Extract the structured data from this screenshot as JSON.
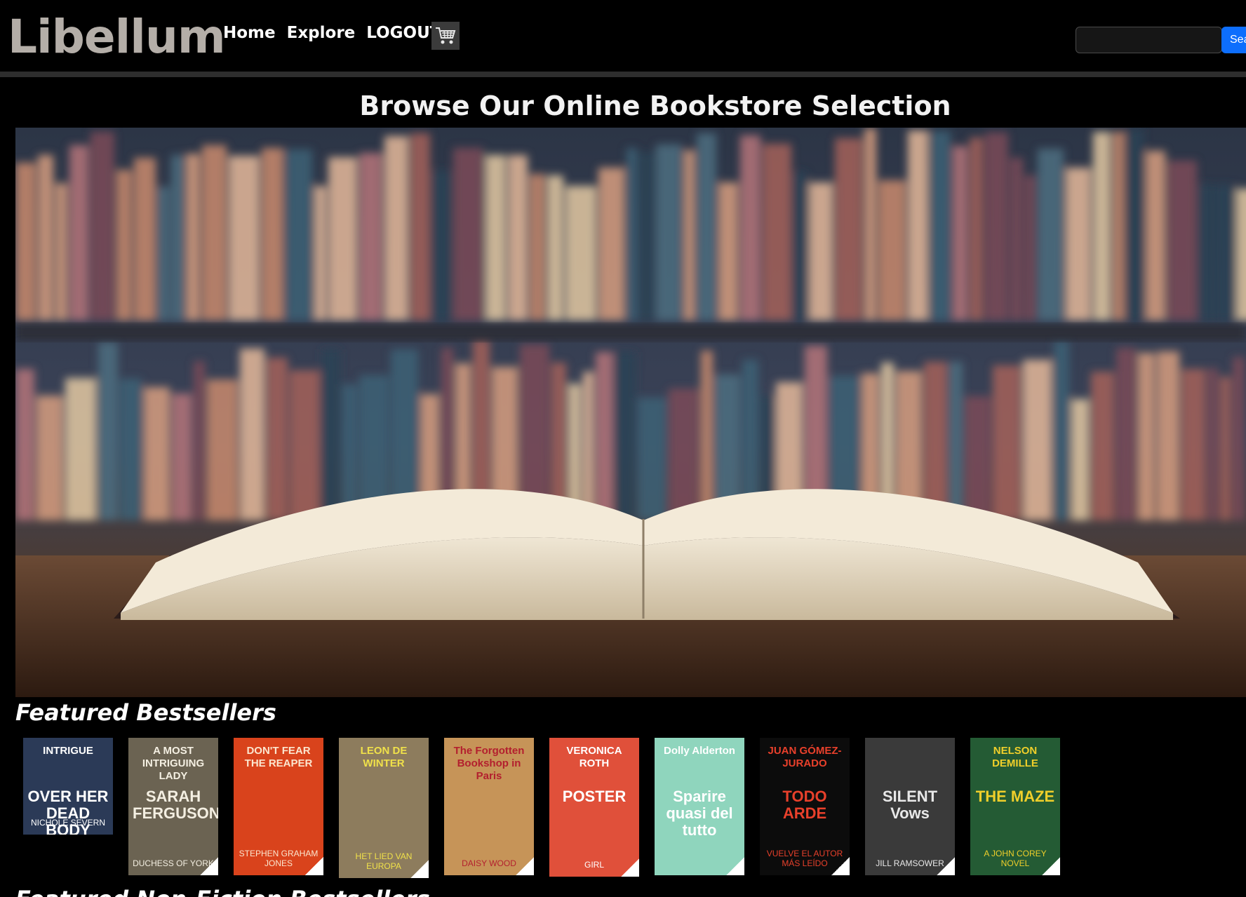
{
  "header": {
    "logo": "Libellum",
    "nav": [
      "Home",
      "Explore",
      "LOGOUT"
    ],
    "cart_icon": "shopping-cart-icon",
    "search_placeholder": "",
    "search_button": "Sea"
  },
  "page_title": "Browse Our Online Bookstore Selection",
  "hero": {
    "description_icon": "open-book-on-shelf-photo"
  },
  "featured": {
    "title": "Featured Bestsellers",
    "books": [
      {
        "lines": [
          "INTRIGUE",
          "OVER HER DEAD BODY",
          "NICHOLE SEVERN"
        ],
        "bg": "#2b3a57",
        "fg": "#ffffff"
      },
      {
        "lines": [
          "A MOST INTRIGUING LADY",
          "SARAH FERGUSON",
          "DUCHESS OF YORK"
        ],
        "bg": "#6b6352",
        "fg": "#f4efe2"
      },
      {
        "lines": [
          "DON'T FEAR THE REAPER",
          "",
          "STEPHEN GRAHAM JONES"
        ],
        "bg": "#d9431c",
        "fg": "#fbe6cf"
      },
      {
        "lines": [
          "LEON DE WINTER",
          "",
          "HET LIED VAN EUROPA"
        ],
        "bg": "#8d7c5d",
        "fg": "#f0e14a"
      },
      {
        "lines": [
          "The Forgotten Bookshop in Paris",
          "",
          "DAISY WOOD"
        ],
        "bg": "#c69458",
        "fg": "#b31f2e"
      },
      {
        "lines": [
          "VERONICA ROTH",
          "POSTER",
          "GIRL"
        ],
        "bg": "#e0503a",
        "fg": "#ffffff"
      },
      {
        "lines": [
          "Dolly Alderton",
          "Sparire quasi del tutto",
          ""
        ],
        "bg": "#8fd5bd",
        "fg": "#ffffff"
      },
      {
        "lines": [
          "JUAN GÓMEZ-JURADO",
          "TODO ARDE",
          "VUELVE EL AUTOR MÁS LEÍDO"
        ],
        "bg": "#0c0c0c",
        "fg": "#e8402b"
      },
      {
        "lines": [
          "",
          "SILENT Vows",
          "JILL RAMSOWER"
        ],
        "bg": "#3a3a3a",
        "fg": "#e8e8e8"
      },
      {
        "lines": [
          "NELSON DEMILLE",
          "THE MAZE",
          "A JOHN COREY NOVEL"
        ],
        "bg": "#245b34",
        "fg": "#f0cf2a"
      }
    ]
  },
  "nonfiction": {
    "title": "Featured Non-Fiction Bestsellers"
  }
}
